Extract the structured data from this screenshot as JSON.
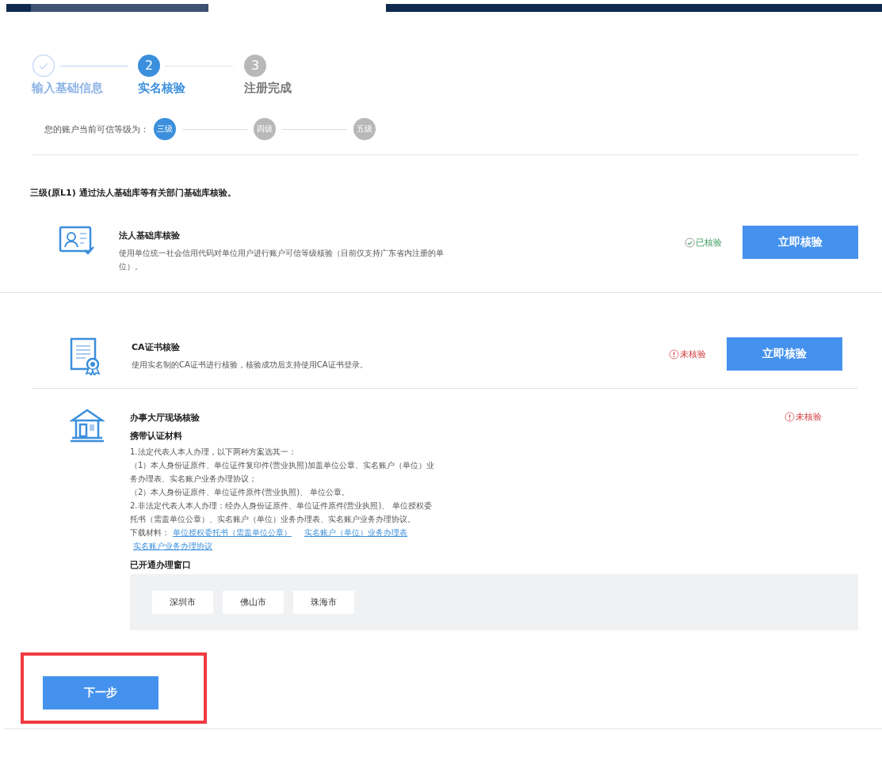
{
  "steps": [
    {
      "label": "输入基础信息",
      "completed": true,
      "selected": false
    },
    {
      "number": "2",
      "label": "实名核验",
      "completed": false,
      "selected": true
    },
    {
      "number": "3",
      "label": "注册完成",
      "completed": false,
      "selected": false
    }
  ],
  "trust_level": {
    "label": "您的账户当前可信等级为：",
    "levels": [
      {
        "label": "三级",
        "selected": true
      },
      {
        "label": "四级",
        "selected": false
      },
      {
        "label": "五级",
        "selected": false
      }
    ]
  },
  "level_heading": "三级(原L1) 通过法人基础库等有关部门基础库核验。",
  "methods": [
    {
      "kind": "legal-db",
      "title": "法人基础库核验",
      "description": "使用单位统一社会信用代码对单位用户进行账户可信等级核验（目前仅支持广东省内注册的单位）。",
      "status": "已核验",
      "verified": true,
      "button": "立即核验"
    },
    {
      "kind": "ca",
      "title": "CA证书核验",
      "description": "使用实名制的CA证书进行核验，核验成功后支持使用CA证书登录。",
      "status": "未核验",
      "verified": false,
      "button": "立即核验"
    },
    {
      "kind": "hall",
      "title": "办事大厅现场核验",
      "status": "未核验",
      "verified": false,
      "materials_heading": "携带认证材料",
      "paragraphs": [
        "1.法定代表人本人办理，以下两种方案选其一：",
        "（1）本人身份证原件、单位证件复印件(营业执照)加盖单位公章、实名账户（单位）业务办理表、实名账户业务办理协议；",
        "（2）本人身份证原件、单位证件原件(营业执照)、 单位公章。",
        "2.非法定代表人本人办理：经办人身份证原件、单位证件原件(营业执照)、 单位授权委托书（需盖单位公章）、实名账户（单位）业务办理表、实名账户业务办理协议。"
      ],
      "download_label": "下载材料：",
      "download_links": [
        "单位授权委托书（需盖单位公章）",
        "实名账户（单位）业务办理表",
        "实名账户业务办理协议"
      ],
      "windows_heading": "已开通办理窗口",
      "windows": [
        "深圳市",
        "佛山市",
        "珠海市"
      ]
    }
  ],
  "next_button": {
    "label": "下一步",
    "highlighted": true
  }
}
